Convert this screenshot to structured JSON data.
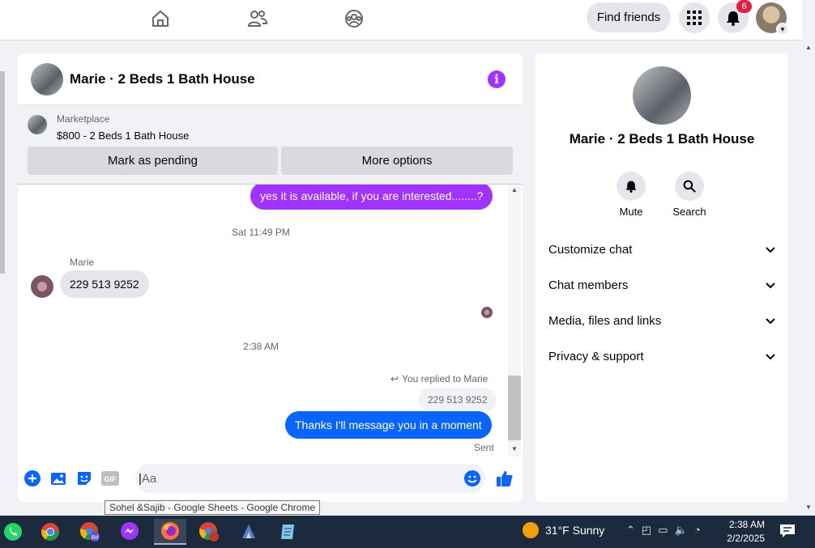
{
  "topbar": {
    "find_friends_label": "Find friends",
    "notifications_count": "6",
    "nav_icons": [
      "home-icon",
      "friends-icon",
      "groups-icon"
    ]
  },
  "chat": {
    "title": "Marie · 2 Beds 1 Bath House",
    "marketplace_label": "Marketplace",
    "listing": "$800 - 2 Beds 1 Bath House",
    "mark_pending_label": "Mark as pending",
    "more_options_label": "More options",
    "messages": {
      "outgoing_1": "yes it is available, if you are interested........?",
      "timestamp_1": "Sat 11:49 PM",
      "sender_name": "Marie",
      "incoming_1": "229 513 9252",
      "timestamp_2": "2:38 AM",
      "reply_note": "You replied to Marie",
      "quoted_reply": "229 513 9252",
      "outgoing_2": "Thanks I'll message you in a moment",
      "status": "Sent"
    },
    "composer_placeholder": "Aa",
    "accent_color": "#a033ff",
    "outgoing_color": "#0866ff"
  },
  "side": {
    "name": "Marie · 2 Beds 1 Bath House",
    "mute_label": "Mute",
    "search_label": "Search",
    "sections": [
      "Customize chat",
      "Chat members",
      "Media, files and links",
      "Privacy & support"
    ]
  },
  "tooltip": "Sohel &Sajib - Google Sheets - Google Chrome",
  "taskbar": {
    "weather": "31°F  Sunny",
    "time": "2:38 AM",
    "date": "2/2/2025"
  }
}
